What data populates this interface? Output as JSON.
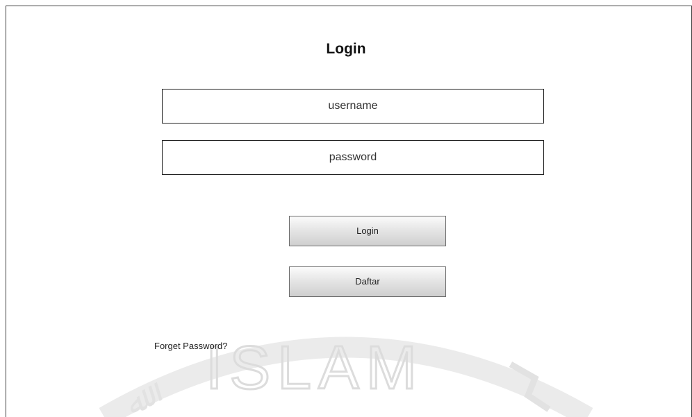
{
  "page": {
    "title": "Login"
  },
  "form": {
    "username_placeholder": "username",
    "password_placeholder": "password",
    "login_label": "Login",
    "register_label": "Daftar",
    "forgot_label": "Forget Password?"
  },
  "watermark": {
    "text": "ISLAM"
  },
  "colors": {
    "border": "#222222",
    "button_top": "#fbfbfb",
    "button_bottom": "#cfcfcf",
    "watermark": "#d9d9d9"
  }
}
